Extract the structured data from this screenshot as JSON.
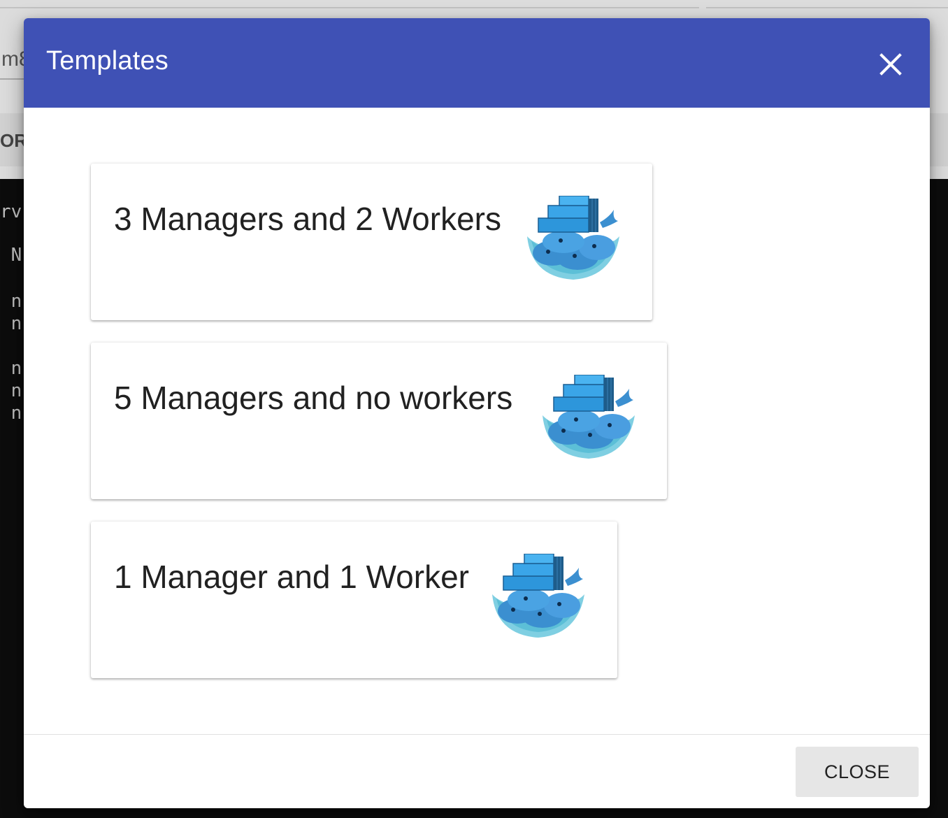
{
  "background": {
    "input_text": "m8",
    "button_text": "OR",
    "terminal_lines": [
      "rv",
      " N",
      " n",
      " n",
      " n",
      " n",
      " n"
    ]
  },
  "dialog": {
    "title": "Templates",
    "close_icon": "close-icon",
    "templates": [
      {
        "label": "3 Managers and 2 Workers",
        "icon": "docker-whale-icon"
      },
      {
        "label": "5 Managers and no workers",
        "icon": "docker-whale-icon"
      },
      {
        "label": "1 Manager and 1 Worker",
        "icon": "docker-whale-icon"
      }
    ],
    "close_button_label": "CLOSE"
  },
  "colors": {
    "header": "#3f51b5",
    "overlay_bg": "#dcdcdc",
    "terminal_bg": "#0c0c0c"
  }
}
